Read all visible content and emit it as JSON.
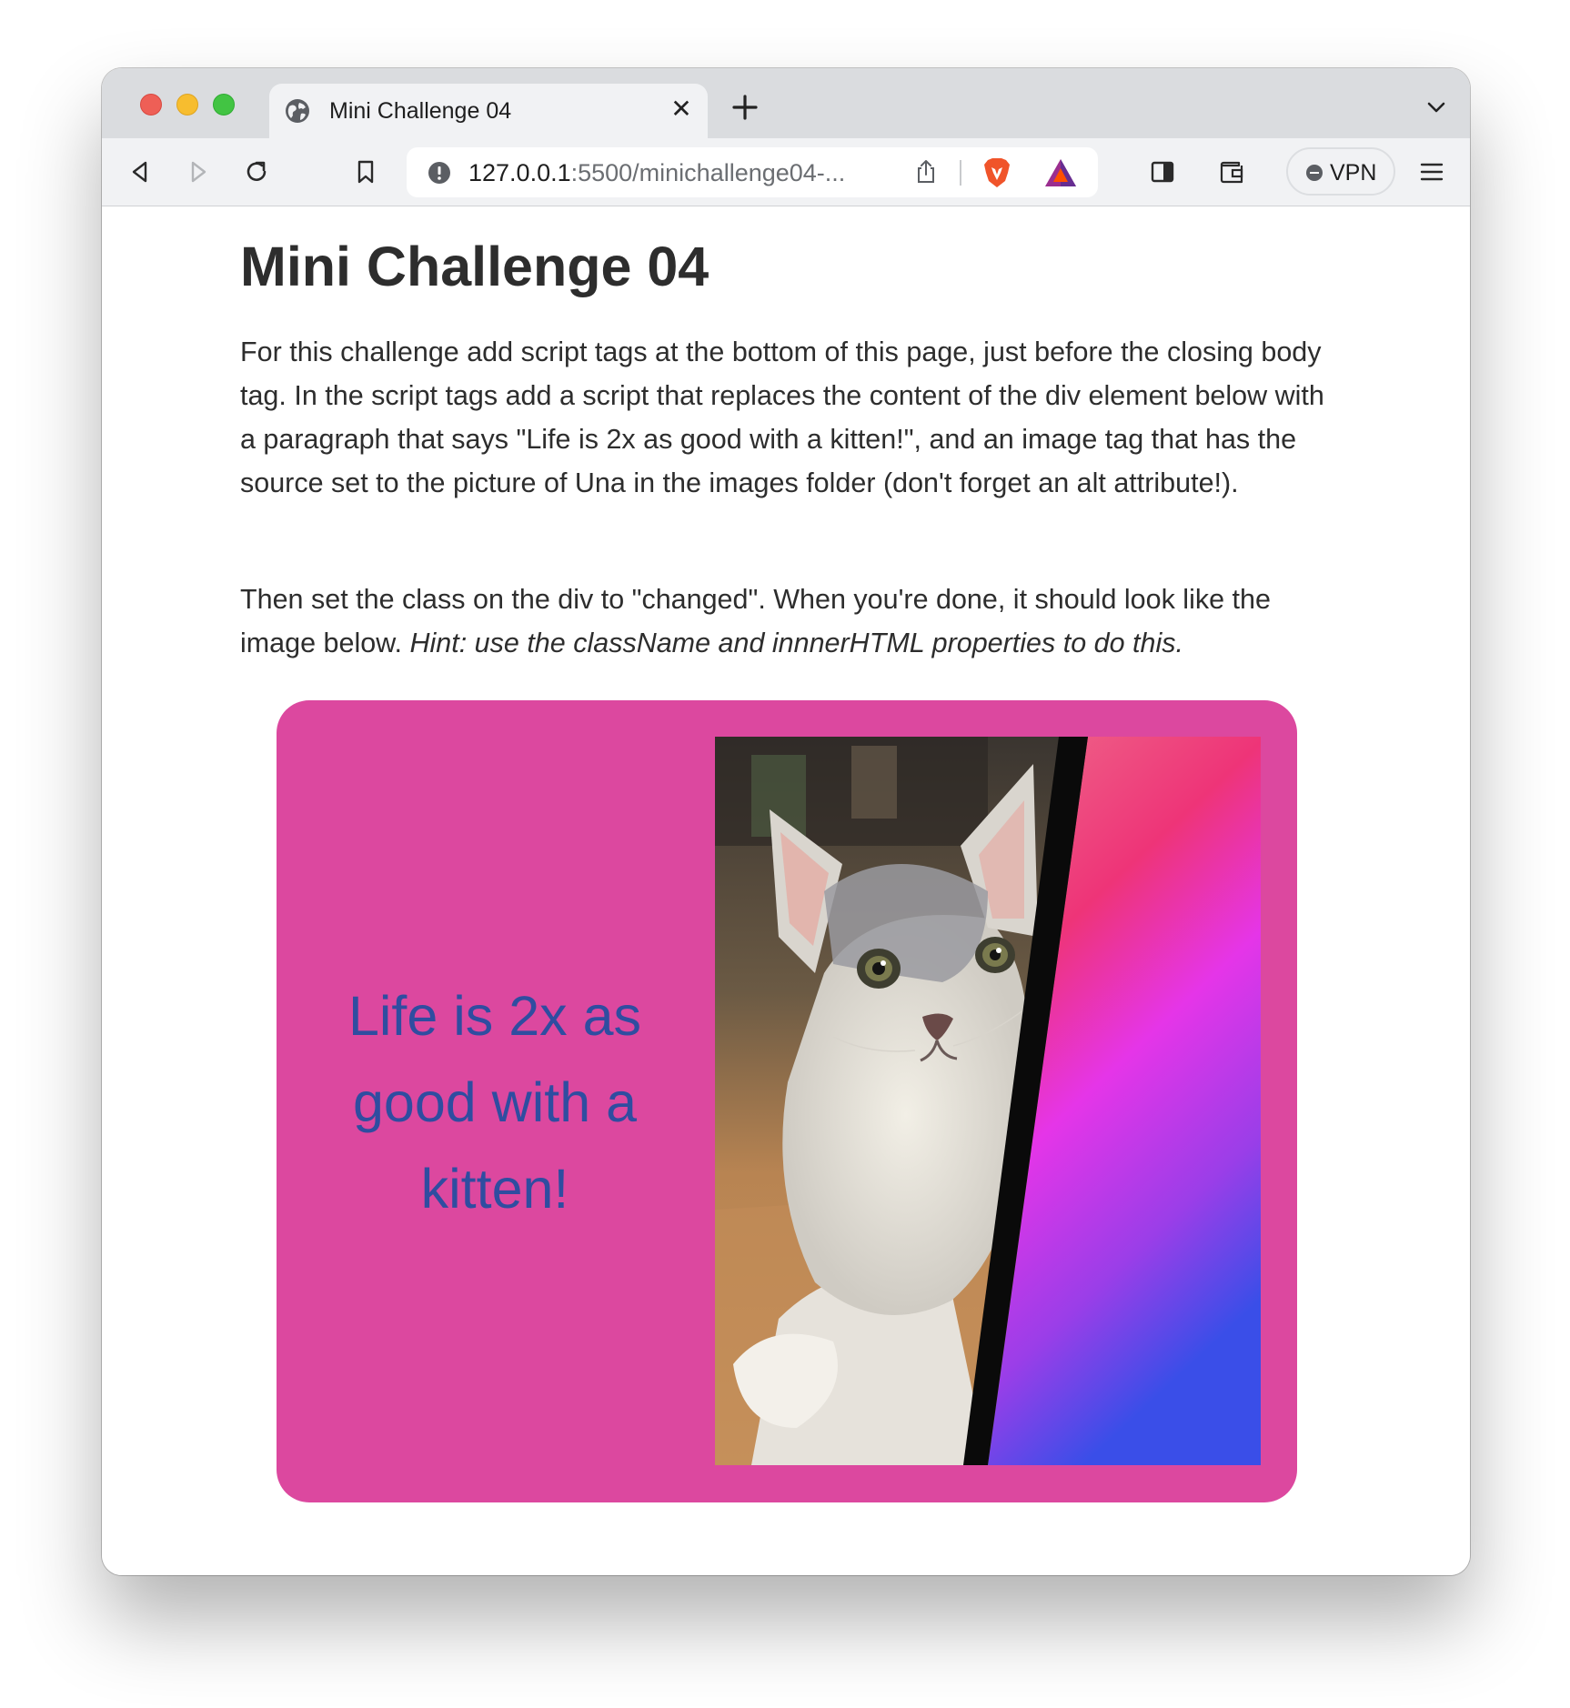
{
  "browser": {
    "tab_title": "Mini Challenge 04",
    "url_host": "127.0.0.1",
    "url_rest": ":5500/minichallenge04-...",
    "vpn_label": "VPN"
  },
  "page": {
    "heading": "Mini Challenge 04",
    "paragraph1": "For this challenge add script tags at the bottom of this page, just before the closing body tag. In the script tags add a script that replaces the content of the div element below with a paragraph that says \"Life is 2x as good with a kitten!\", and an image tag that has the source set to the picture of Una in the images folder (don't forget an alt attribute!).",
    "paragraph2_text": "Then set the class on the div to \"changed\". When you're done, it should look like the image below. ",
    "paragraph2_hint": "Hint: use the className and innnerHTML properties to do this.",
    "changed_div": {
      "text": "Life is 2x as good with a kitten!",
      "background": "#dc489f",
      "text_color": "#2f4da0"
    }
  },
  "icons": [
    "globe-icon",
    "close-icon",
    "plus-icon",
    "chevron-down-icon",
    "back-icon",
    "forward-icon",
    "reload-icon",
    "bookmark-icon",
    "info-icon",
    "share-icon",
    "brave-lion-icon",
    "bat-rewards-icon",
    "sidebar-icon",
    "wallet-icon",
    "vpn-icon",
    "menu-icon"
  ]
}
